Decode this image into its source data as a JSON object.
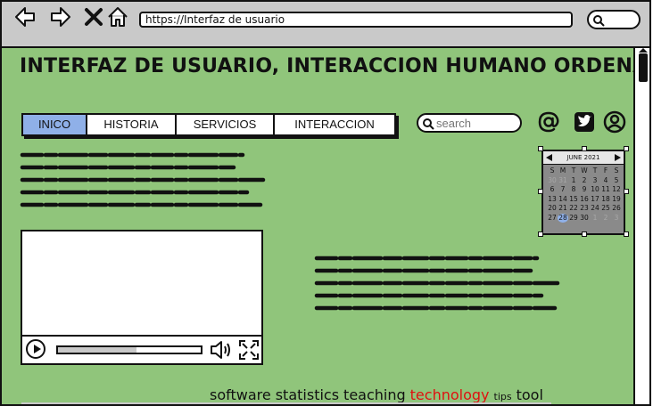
{
  "browser": {
    "url": "https://Interfaz de usuario",
    "nav_icons": [
      "back-arrow-icon",
      "forward-arrow-icon",
      "close-icon",
      "home-icon"
    ],
    "search_icon": "search-icon"
  },
  "page": {
    "title": "INTERFAZ DE USUARIO, INTERACCION HUMANO ORDENADOR",
    "background_color": "#90c57b"
  },
  "nav": {
    "tabs": [
      {
        "label": "INICO",
        "active": true
      },
      {
        "label": "HISTORIA",
        "active": false
      },
      {
        "label": "SERVICIOS",
        "active": false
      },
      {
        "label": "INTERACCION",
        "active": false
      }
    ],
    "active_color": "#8fb0e8"
  },
  "search": {
    "placeholder": "search"
  },
  "social_icons": [
    "at-sign-icon",
    "twitter-icon",
    "user-profile-icon"
  ],
  "calendar": {
    "month_label": "JUNE 2021",
    "weekdays": [
      "S",
      "M",
      "T",
      "W",
      "T",
      "F",
      "S"
    ],
    "days": [
      {
        "d": "30",
        "muted": true
      },
      {
        "d": "31",
        "muted": true
      },
      {
        "d": "1"
      },
      {
        "d": "2"
      },
      {
        "d": "3"
      },
      {
        "d": "4"
      },
      {
        "d": "5"
      },
      {
        "d": "6"
      },
      {
        "d": "7"
      },
      {
        "d": "8"
      },
      {
        "d": "9"
      },
      {
        "d": "10"
      },
      {
        "d": "11"
      },
      {
        "d": "12"
      },
      {
        "d": "13"
      },
      {
        "d": "14"
      },
      {
        "d": "15"
      },
      {
        "d": "16"
      },
      {
        "d": "17"
      },
      {
        "d": "18"
      },
      {
        "d": "19"
      },
      {
        "d": "20"
      },
      {
        "d": "21"
      },
      {
        "d": "22"
      },
      {
        "d": "23"
      },
      {
        "d": "24"
      },
      {
        "d": "25"
      },
      {
        "d": "26"
      },
      {
        "d": "27"
      },
      {
        "d": "28",
        "today": true
      },
      {
        "d": "29"
      },
      {
        "d": "30"
      },
      {
        "d": "1",
        "muted": true
      },
      {
        "d": "2",
        "muted": true
      },
      {
        "d": "3",
        "muted": true
      }
    ]
  },
  "video": {
    "progress": 0.55,
    "icons": [
      "play-icon",
      "volume-icon",
      "fullscreen-icon"
    ]
  },
  "tags": [
    {
      "text": "software",
      "size": 16,
      "color": "#111111"
    },
    {
      "text": "statistics",
      "size": 16,
      "color": "#111111"
    },
    {
      "text": "teaching",
      "size": 16,
      "color": "#111111"
    },
    {
      "text": "technology",
      "size": 16,
      "color": "#e01010"
    },
    {
      "text": "tips",
      "size": 11,
      "color": "#111111"
    },
    {
      "text": "tool",
      "size": 16,
      "color": "#111111"
    }
  ]
}
